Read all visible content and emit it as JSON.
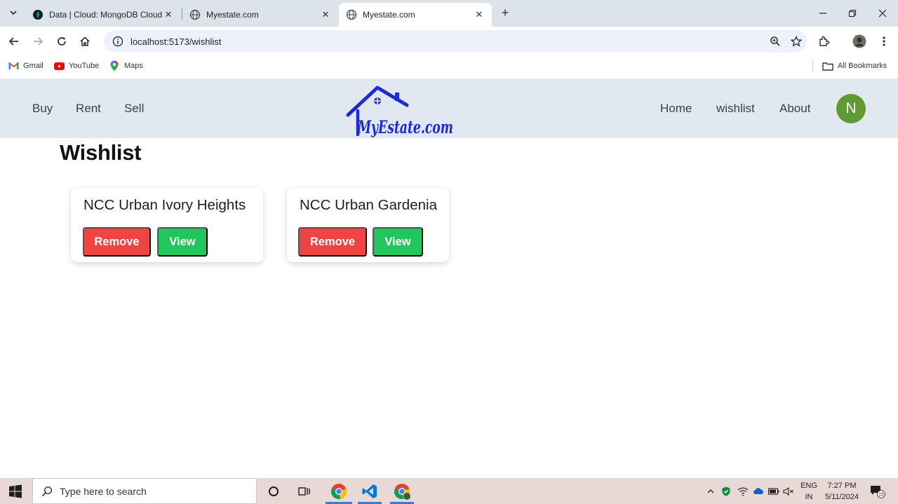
{
  "browser": {
    "tabs": [
      {
        "title": "Data | Cloud: MongoDB Cloud",
        "favicon": "mongodb-leaf-icon",
        "active": false
      },
      {
        "title": "Myestate.com",
        "favicon": "globe-icon",
        "active": false
      },
      {
        "title": "Myestate.com",
        "favicon": "globe-icon",
        "active": true
      }
    ],
    "new_tab_label": "+",
    "url": "localhost:5173/wishlist",
    "bookmarks": [
      {
        "label": "Gmail",
        "icon": "gmail-icon"
      },
      {
        "label": "YouTube",
        "icon": "youtube-icon"
      },
      {
        "label": "Maps",
        "icon": "maps-pin-icon"
      }
    ],
    "all_bookmarks_label": "All Bookmarks"
  },
  "navbar": {
    "left_links": [
      "Buy",
      "Rent",
      "Sell"
    ],
    "logo_text": "MyEstate.com",
    "right_links": [
      "Home",
      "wishlist",
      "About"
    ],
    "avatar_initial": "N",
    "avatar_color": "#5f9a35"
  },
  "page": {
    "title": "Wishlist",
    "items": [
      {
        "name": "NCC Urban Ivory Heights",
        "remove_label": "Remove",
        "view_label": "View"
      },
      {
        "name": "NCC Urban Gardenia",
        "remove_label": "Remove",
        "view_label": "View"
      }
    ]
  },
  "colors": {
    "navbar_bg": "#e2e8f0",
    "remove_btn": "#ef4444",
    "view_btn": "#22c55e",
    "logo_blue": "#1a2bd4"
  },
  "taskbar": {
    "search_placeholder": "Type here to search",
    "language": [
      "ENG",
      "IN"
    ],
    "time": "7:27 PM",
    "date": "5/11/2024",
    "notification_count": "15"
  }
}
